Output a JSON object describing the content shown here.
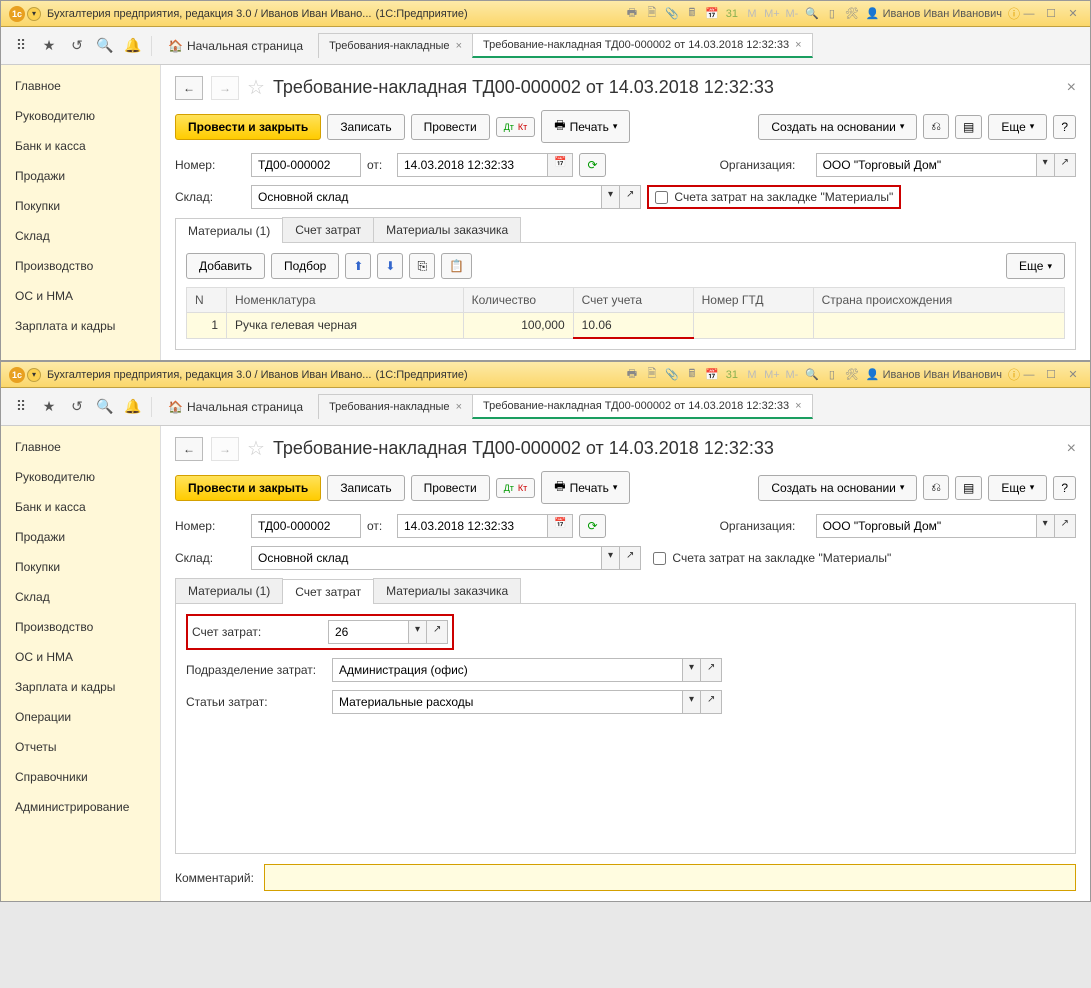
{
  "titlebar": {
    "title": "Бухгалтерия предприятия, редакция 3.0 / Иванов Иван Ивано...",
    "platform": "(1С:Предприятие)",
    "user": "Иванов Иван Иванович"
  },
  "topbar": {
    "home": "Начальная страница",
    "tabs": [
      {
        "label": "Требования-накладные",
        "active": false
      },
      {
        "label": "Требование-накладная ТД00-000002 от 14.03.2018 12:32:33",
        "active": true
      }
    ]
  },
  "sidebar": {
    "items": [
      "Главное",
      "Руководителю",
      "Банк и касса",
      "Продажи",
      "Покупки",
      "Склад",
      "Производство",
      "ОС и НМА",
      "Зарплата и кадры",
      "Операции",
      "Отчеты",
      "Справочники",
      "Администрирование"
    ]
  },
  "doc": {
    "title": "Требование-накладная ТД00-000002 от 14.03.2018 12:32:33",
    "actions": {
      "post_close": "Провести и закрыть",
      "save": "Записать",
      "post": "Провести",
      "print": "Печать",
      "create_based": "Создать на основании",
      "more": "Еще"
    },
    "fields": {
      "number_label": "Номер:",
      "number": "ТД00-000002",
      "from_label": "от:",
      "date": "14.03.2018 12:32:33",
      "org_label": "Организация:",
      "org": "ООО \"Торговый Дом\"",
      "warehouse_label": "Склад:",
      "warehouse": "Основной склад",
      "checkbox_label": "Счета затрат на закладке \"Материалы\""
    },
    "tabs1": [
      "Материалы (1)",
      "Счет затрат",
      "Материалы заказчика"
    ],
    "tabs1_active": 0,
    "tabs2_active": 1,
    "table_actions": {
      "add": "Добавить",
      "pick": "Подбор",
      "more": "Еще"
    },
    "table": {
      "cols": [
        "N",
        "Номенклатура",
        "Количество",
        "Счет учета",
        "Номер ГТД",
        "Страна происхождения"
      ],
      "rows": [
        {
          "n": "1",
          "item": "Ручка гелевая черная",
          "qty": "100,000",
          "acct": "10.06",
          "gtd": "",
          "country": ""
        }
      ]
    },
    "cost_tab": {
      "account_label": "Счет затрат:",
      "account": "26",
      "dept_label": "Подразделение затрат:",
      "dept": "Администрация (офис)",
      "item_label": "Статьи затрат:",
      "item": "Материальные расходы"
    },
    "comment_label": "Комментарий:"
  }
}
